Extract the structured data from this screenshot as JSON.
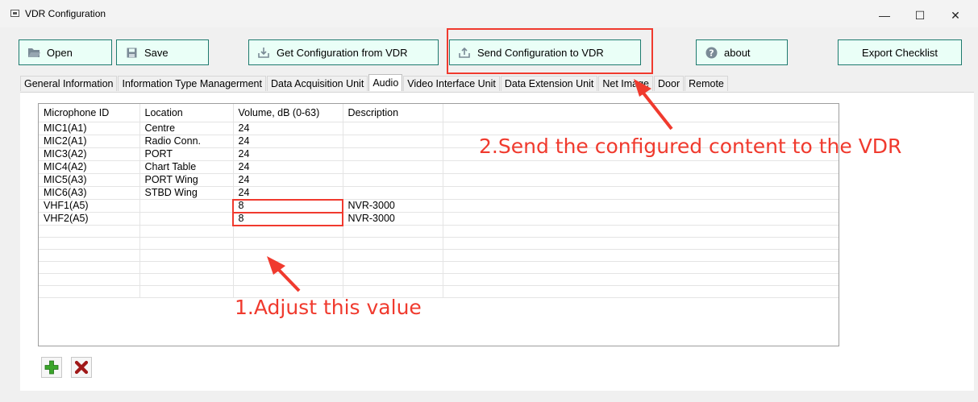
{
  "window": {
    "title": "VDR Configuration",
    "controls": {
      "minimize": "—",
      "maximize": "☐",
      "close": "✕"
    }
  },
  "toolbar": {
    "open_label": "Open",
    "save_label": "Save",
    "get_config_label": "Get Configuration from VDR",
    "send_config_label": "Send Configuration to VDR",
    "about_label": "about",
    "export_label": "Export Checklist"
  },
  "tabs": [
    {
      "label": "General Information"
    },
    {
      "label": "Information Type Managerment"
    },
    {
      "label": "Data Acquisition Unit"
    },
    {
      "label": "Audio",
      "active": true
    },
    {
      "label": "Video Interface Unit"
    },
    {
      "label": "Data Extension Unit"
    },
    {
      "label": "Net Image"
    },
    {
      "label": "Door"
    },
    {
      "label": "Remote"
    }
  ],
  "audio_table": {
    "columns": [
      "Microphone ID",
      "Location",
      "Volume, dB (0-63)",
      "Description"
    ],
    "rows": [
      [
        "MIC1(A1)",
        "Centre",
        "24",
        ""
      ],
      [
        "MIC2(A1)",
        "Radio Conn.",
        "24",
        ""
      ],
      [
        "MIC3(A2)",
        "PORT",
        "24",
        ""
      ],
      [
        "MIC4(A2)",
        "Chart Table",
        "24",
        ""
      ],
      [
        "MIC5(A3)",
        "PORT Wing",
        "24",
        ""
      ],
      [
        "MIC6(A3)",
        "STBD Wing",
        "24",
        ""
      ],
      [
        "VHF1(A5)",
        "",
        "8",
        "NVR-3000"
      ],
      [
        "VHF2(A5)",
        "",
        "8",
        "NVR-3000"
      ]
    ],
    "empty_rows": 6
  },
  "annotations": {
    "step1": "1.Adjust this value",
    "step2": "2.Send the configured content to the VDR",
    "color": "#f03a2e"
  },
  "colors": {
    "button_border": "#1e7a6e",
    "button_fill": "#eafff7",
    "add_icon": "#3aa52a",
    "delete_icon": "#a01818"
  }
}
